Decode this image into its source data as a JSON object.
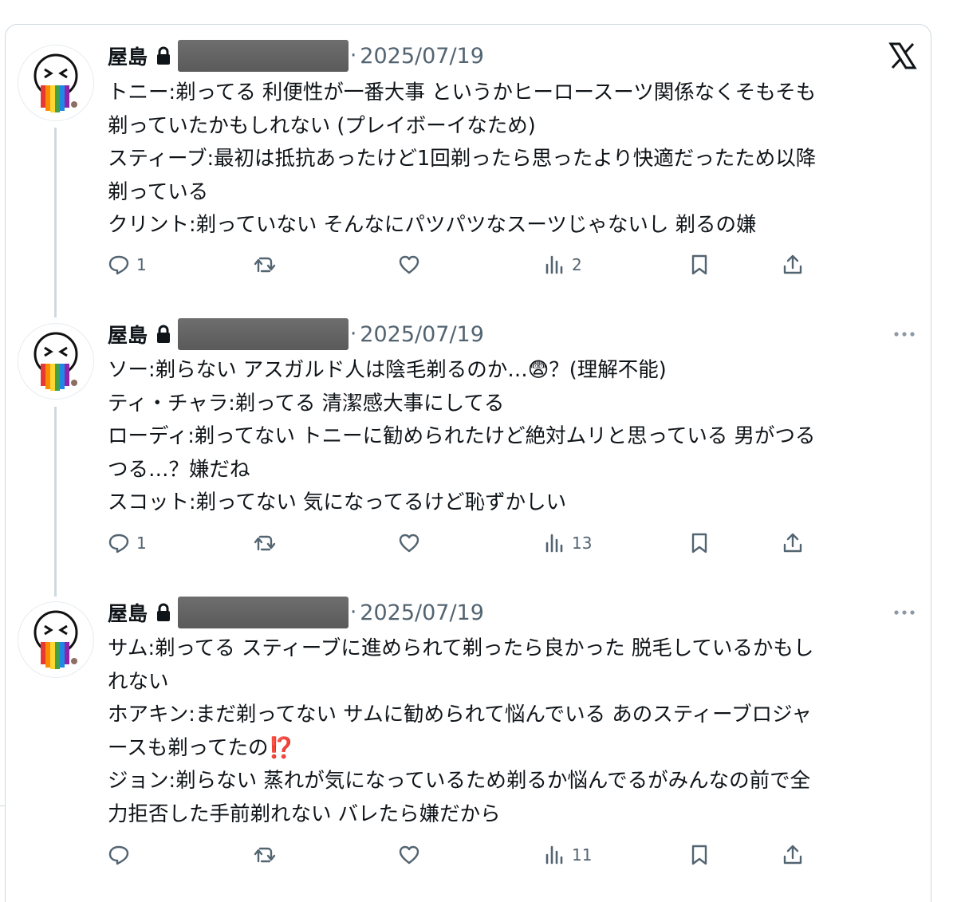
{
  "tweets": [
    {
      "name": "屋島",
      "sep": "·",
      "date": "2025/07/19",
      "lines": [
        "トニー:剃ってる 利便性が一番大事 というかヒーロースーツ関係なくそもそも",
        "剃っていたかもしれない (プレイボーイなため)",
        "スティーブ:最初は抵抗あったけど1回剃ったら思ったより快適だったため以降",
        "剃っている",
        "クリント:剃っていない そんなにパツパツなスーツじゃないし 剃るの嫌"
      ],
      "replies": "1",
      "views": "2"
    },
    {
      "name": "屋島",
      "sep": "·",
      "date": "2025/07/19",
      "lines": [
        "ソー:剃らない アスガルド人は陰毛剃るのか…😨？(理解不能)",
        "ティ・チャラ:剃ってる 清潔感大事にしてる",
        "ローディ:剃ってない トニーに勧められたけど絶対ムリと思っている 男がつる",
        "つる…？嫌だね",
        "スコット:剃ってない 気になってるけど恥ずかしい"
      ],
      "replies": "1",
      "views": "13"
    },
    {
      "name": "屋島",
      "sep": "·",
      "date": "2025/07/19",
      "lines": [
        "サム:剃ってる スティーブに進められて剃ったら良かった 脱毛しているかもし",
        "れない",
        "ホアキン:まだ剃ってない サムに勧められて悩んでいる あのスティーブロジャ",
        "ースも剃ってたの⁉️",
        "ジョン:剃らない 蒸れが気になっているため剃るか悩んでるがみんなの前で全",
        "力拒否した手前剃れない バレたら嫌だから"
      ],
      "replies": "",
      "views": "11"
    }
  ],
  "icons": {
    "lock": "lock-icon",
    "x_logo": "x-logo-icon",
    "more": "more-dots-icon",
    "reply": "reply-icon",
    "retweet": "retweet-icon",
    "like": "heart-icon",
    "views": "views-icon",
    "bookmark": "bookmark-icon",
    "share": "share-icon"
  },
  "colors": {
    "text": "#0f1419",
    "secondary": "#536471",
    "border": "#cfd9de",
    "redaction": "#5f5f5f"
  }
}
